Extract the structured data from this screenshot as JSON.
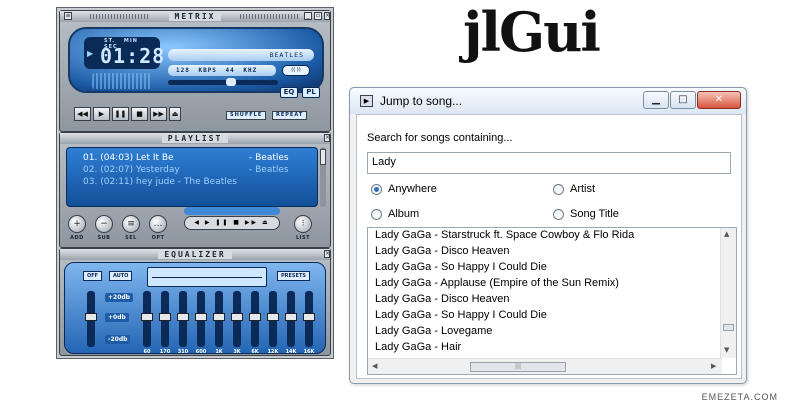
{
  "player": {
    "main_title": "METRIX",
    "lcd_labels": "ST. MIN SEC",
    "time": "01:28",
    "song_title": "BEATLES",
    "bitrate": "128",
    "bitrate_unit": "KBPS",
    "samplerate": "44",
    "samplerate_unit": "KHZ",
    "eq_button": "EQ",
    "pl_button": "PL",
    "shuffle_button": "SHUFFLE",
    "repeat_button": "REPEAT",
    "seek_position": 0.58
  },
  "playlist": {
    "title": "PLAYLIST",
    "items": [
      {
        "number": "01.",
        "length": "(04:03)",
        "title": "Let It Be",
        "artist": "- Beatles"
      },
      {
        "number": "02.",
        "length": "(02:07)",
        "title": "Yesterday",
        "artist": "- Beatles"
      },
      {
        "number": "03.",
        "length": "(02:11)",
        "title": "hey jude - The Beatles",
        "artist": ""
      }
    ],
    "buttons": [
      {
        "label": "ADD",
        "glyph": "+"
      },
      {
        "label": "SUB",
        "glyph": "−"
      },
      {
        "label": "SEL",
        "glyph": "≡"
      },
      {
        "label": "OPT",
        "glyph": "…"
      }
    ],
    "list_button": "LIST"
  },
  "equalizer": {
    "title": "EQUALIZER",
    "off": "OFF",
    "auto": "AUTO",
    "presets": "PRESETS",
    "db_top": "+20db",
    "db_mid": "+0db",
    "db_bottom": "-20db",
    "bands": [
      "60",
      "170",
      "310",
      "600",
      "1K",
      "3K",
      "6K",
      "12K",
      "14K",
      "16K"
    ]
  },
  "brand": "jlGui",
  "dialog": {
    "title": "Jump to song...",
    "prompt": "Search for songs containing...",
    "search_value": "Lady",
    "options": {
      "anywhere": "Anywhere",
      "artist": "Artist",
      "album": "Album",
      "song_title": "Song Title"
    },
    "selected_option": "anywhere",
    "results": [
      "Lady GaGa - Starstruck ft. Space Cowboy & Flo Rida",
      "Lady GaGa - Disco Heaven",
      "Lady GaGa - So Happy I Could Die",
      "Lady GaGa - Applause (Empire of the Sun Remix)",
      "Lady GaGa - Disco Heaven",
      "Lady GaGa - So Happy I Could Die",
      "Lady GaGa - Lovegame",
      "Lady GaGa - Hair"
    ]
  },
  "watermark": "EMEZETA.COM"
}
